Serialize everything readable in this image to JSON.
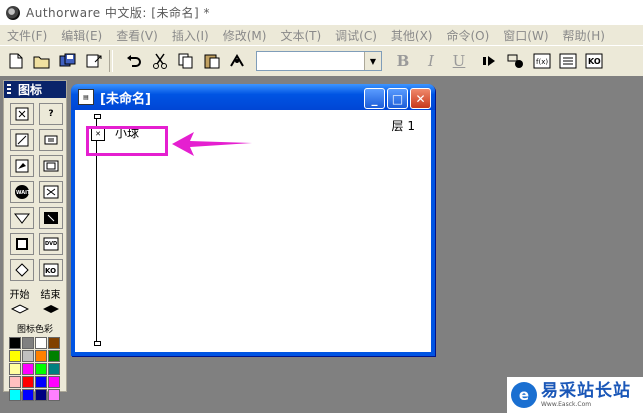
{
  "window": {
    "title": "Authorware 中文版: [未命名] *"
  },
  "menubar": {
    "items": [
      {
        "label": "文件(F)"
      },
      {
        "label": "编辑(E)"
      },
      {
        "label": "查看(V)"
      },
      {
        "label": "插入(I)"
      },
      {
        "label": "修改(M)"
      },
      {
        "label": "文本(T)"
      },
      {
        "label": "调试(C)"
      },
      {
        "label": "其他(X)"
      },
      {
        "label": "命令(O)"
      },
      {
        "label": "窗口(W)"
      },
      {
        "label": "帮助(H)"
      }
    ]
  },
  "toolbar": {
    "font_combo_value": "",
    "bold_label": "B",
    "italic_label": "I",
    "underline_label": "U"
  },
  "palette": {
    "title": "图标",
    "start_label": "开始",
    "end_label": "结束",
    "color_label": "图标色彩",
    "swatch_colors": [
      "#000000",
      "#808080",
      "#ffffff",
      "#804000",
      "#ffff00",
      "#c0c0c0",
      "#ff8000",
      "#008000",
      "#ffffa0",
      "#ff00ff",
      "#00ff00",
      "#008080",
      "#ffc0c0",
      "#ff0000",
      "#0000ff",
      "#ff00ff",
      "#00ffff",
      "#0000ff",
      "#000080",
      "#ff80ff"
    ]
  },
  "flow_window": {
    "title": "[未命名]",
    "level_label": "层 1",
    "icon_label": "小球"
  },
  "watermark": {
    "name": "易采站长站",
    "url": "Www.Easck.Com"
  },
  "colors": {
    "highlight": "#e51fd0",
    "titlebar_blue": "#0054e3"
  }
}
